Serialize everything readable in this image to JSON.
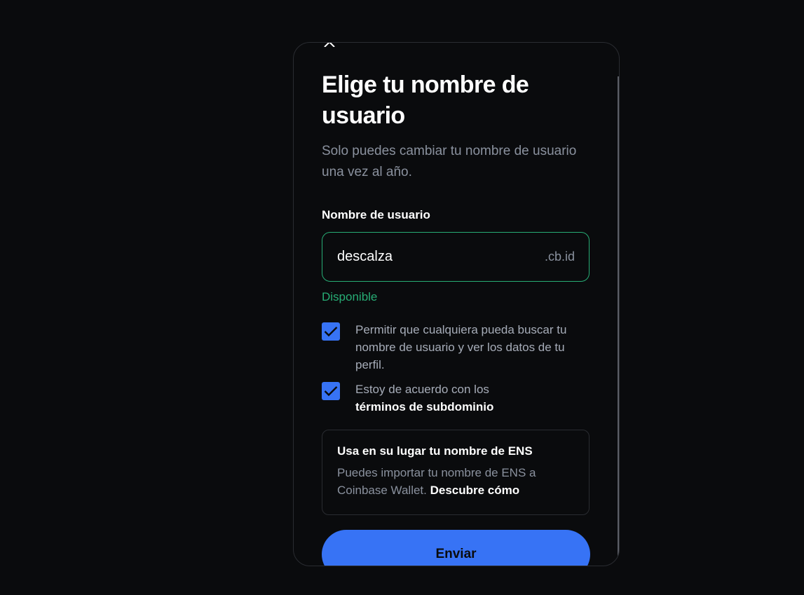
{
  "modal": {
    "title": "Elige tu nombre de usuario",
    "subtitle": "Solo puedes cambiar tu nombre de usuario una vez al año.",
    "close_icon": "close-icon"
  },
  "username": {
    "label": "Nombre de usuario",
    "value": "descalza",
    "suffix": ".cb.id",
    "status": "Disponible",
    "status_color": "#27ad75"
  },
  "checkboxes": [
    {
      "text": "Permitir que cualquiera pueda buscar tu nombre de usuario y ver los datos de tu perfil.",
      "checked": true
    },
    {
      "text": "Estoy de acuerdo con los",
      "link": "términos de subdominio",
      "checked": true
    }
  ],
  "ens": {
    "title": "Usa en su lugar tu nombre de ENS",
    "description": "Puedes importar tu nombre de ENS a Coinbase Wallet.",
    "link": "Descubre cómo"
  },
  "submit": {
    "label": "Enviar",
    "color": "#3773f5"
  }
}
